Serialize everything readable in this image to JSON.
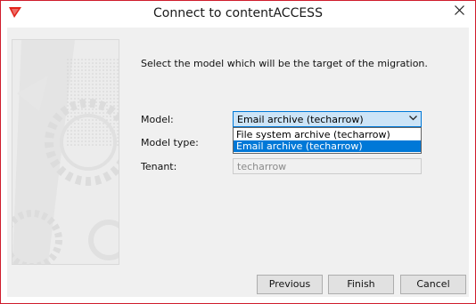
{
  "window": {
    "title": "Connect to contentACCESS"
  },
  "instruction": "Select the model which will be the target of the migration.",
  "fields": {
    "model_label": "Model:",
    "model_value": "Email archive (techarrow)",
    "model_type_label": "Model type:",
    "tenant_label": "Tenant:",
    "tenant_value": "techarrow"
  },
  "dropdown": {
    "options": [
      "File system archive (techarrow)",
      "Email archive (techarrow)"
    ],
    "selected_index": 1
  },
  "buttons": {
    "previous": "Previous",
    "finish": "Finish",
    "cancel": "Cancel"
  },
  "colors": {
    "accent": "#0078d7",
    "window_border": "#d01c2c",
    "brand_icon": "#e2231a"
  }
}
